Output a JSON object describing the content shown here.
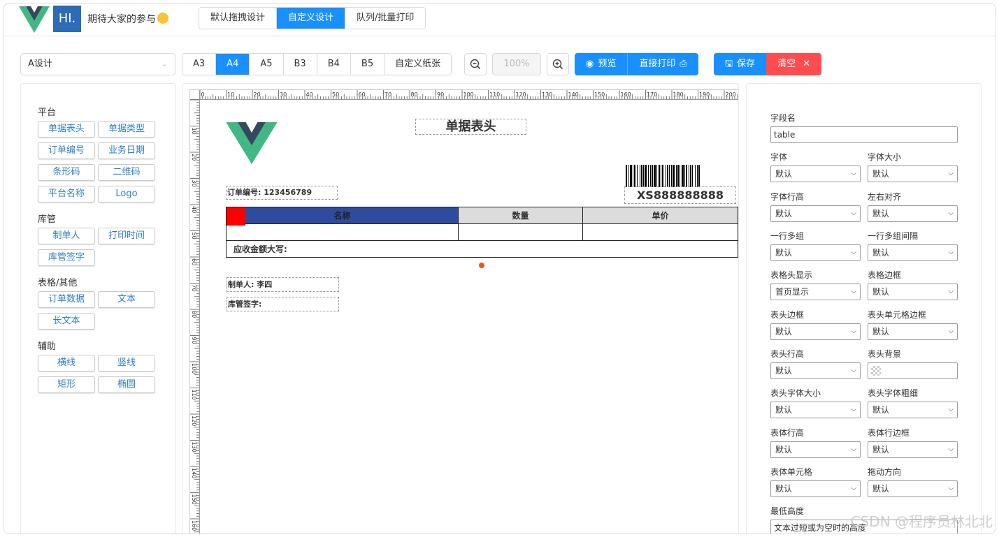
{
  "header": {
    "hi_logo": "HI.",
    "text": "期待大家的参与",
    "mode_tabs": [
      "默认拖拽设计",
      "自定义设计",
      "队列/批量打印"
    ],
    "active_mode": 1
  },
  "toolbar": {
    "template_select": "A设计",
    "paper_sizes": [
      "A3",
      "A4",
      "A5",
      "B3",
      "B4",
      "B5",
      "自定义纸张"
    ],
    "active_paper": 1,
    "zoom": "100%",
    "preview_label": "预览",
    "print_label": "直接打印",
    "save_label": "保存",
    "clear_label": "清空"
  },
  "left_panel": {
    "sections": [
      {
        "title": "平台",
        "items": [
          "单据表头",
          "单据类型",
          "订单编号",
          "业务日期",
          "条形码",
          "二维码",
          "平台名称",
          "Logo"
        ]
      },
      {
        "title": "库管",
        "items": [
          "制单人",
          "打印时间",
          "库管签字"
        ]
      },
      {
        "title": "表格/其他",
        "items": [
          "订单数据",
          "文本",
          "长文本"
        ]
      },
      {
        "title": "辅助",
        "items": [
          "横线",
          "竖线",
          "矩形",
          "椭圆"
        ]
      }
    ]
  },
  "canvas": {
    "ruler_top": [
      "0",
      "10",
      "20",
      "30",
      "40",
      "50",
      "60",
      "70",
      "80",
      "90",
      "100",
      "110",
      "120",
      "130",
      "140",
      "150",
      "160",
      "170",
      "180",
      "190",
      "200"
    ],
    "ruler_left": [
      "10",
      "20",
      "30",
      "40",
      "50",
      "60",
      "70",
      "80",
      "90",
      "100",
      "110",
      "120",
      "130",
      "140",
      "150",
      "160"
    ],
    "title": "单据表头",
    "order_no": "订单编号: 123456789",
    "barcode_text": "XS888888888",
    "table_headers": [
      "名称",
      "数量",
      "单价"
    ],
    "table_footer": "应收金额大写:",
    "maker": "制单人: 李四",
    "keeper_sign": "库管签字:",
    "colors": {
      "header_bg": "#2e4b9f",
      "header_cell_bg": "#dcdcdc",
      "marker": "#ff0000",
      "dot": "#e8561c"
    }
  },
  "right_panel": {
    "field_name_label": "字段名",
    "field_name_value": "table",
    "fields": [
      {
        "label": "字体",
        "value": "默认"
      },
      {
        "label": "字体大小",
        "value": "默认"
      },
      {
        "label": "字体行高",
        "value": "默认"
      },
      {
        "label": "左右对齐",
        "value": "默认"
      },
      {
        "label": "一行多组",
        "value": "默认"
      },
      {
        "label": "一行多组间隔",
        "value": "默认"
      },
      {
        "label": "表格头显示",
        "value": "首页显示"
      },
      {
        "label": "表格边框",
        "value": "默认"
      },
      {
        "label": "表头边框",
        "value": "默认"
      },
      {
        "label": "表头单元格边框",
        "value": "默认"
      },
      {
        "label": "表头行高",
        "value": "默认"
      },
      {
        "label": "表头背景",
        "value": ""
      },
      {
        "label": "表头字体大小",
        "value": "默认"
      },
      {
        "label": "表头字体粗细",
        "value": "默认"
      },
      {
        "label": "表体行高",
        "value": "默认"
      },
      {
        "label": "表体行边框",
        "value": "默认"
      },
      {
        "label": "表体单元格",
        "value": "默认"
      },
      {
        "label": "拖动方向",
        "value": "默认"
      }
    ],
    "min_height_label": "最低高度",
    "min_height_value": "文本过短或为空时的高度"
  },
  "watermark": "CSDN @程序员林北北",
  "colors": {
    "primary": "#1890ff",
    "danger": "#ff4d4f",
    "link": "#2f7fc1"
  }
}
